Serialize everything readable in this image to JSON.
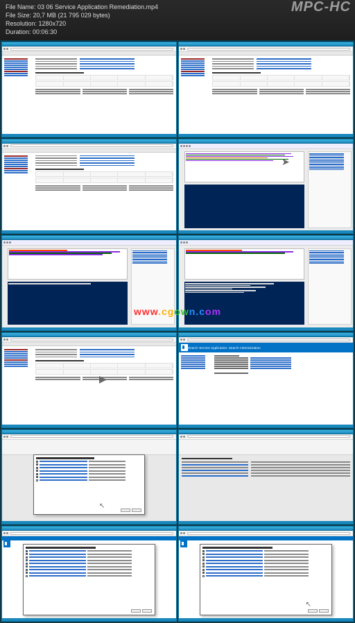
{
  "header": {
    "file_name_label": "File Name:",
    "file_name": "03 06 Service Application Remediation.mp4",
    "file_size_label": "File Size:",
    "file_size": "20,7 MB (21 795 029 bytes)",
    "resolution_label": "Resolution:",
    "resolution": "1280x720",
    "duration_label": "Duration:",
    "duration": "00:06:30",
    "player": "MPC-HC"
  },
  "watermark": "www.cgown.com",
  "thumbs": {
    "topology_heading": "Search Application Topology",
    "sp_title": "Search Service Application: Search Administration",
    "sp_sys_status": "System Status",
    "dialog5_title": "Configure Service Application Associations",
    "dialog6_title": "Configure Service Application Associations",
    "dialog_ok": "OK",
    "dialog_cancel": "Cancel"
  }
}
